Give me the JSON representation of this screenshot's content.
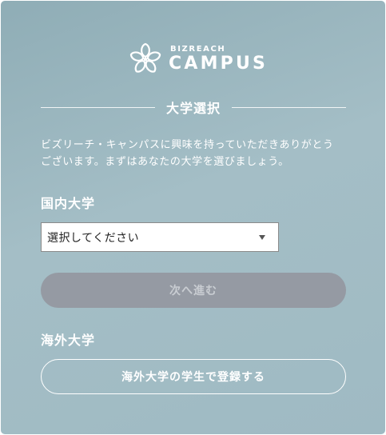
{
  "logo": {
    "sub": "BIZREACH",
    "main": "CAMPUS"
  },
  "section_title": "大学選択",
  "intro": {
    "line1": "ビズリーチ・キャンパスに興味を持っていただきありがとう",
    "line2": "ございます。まずはあなたの大学を選びましょう。"
  },
  "domestic": {
    "label": "国内大学",
    "select_value": "選択してください",
    "next_button": "次へ進む"
  },
  "overseas": {
    "label": "海外大学",
    "button": "海外大学の学生で登録する"
  },
  "colors": {
    "background": "#9fbac3",
    "disabled_button": "#959aa3",
    "text": "#ffffff"
  }
}
